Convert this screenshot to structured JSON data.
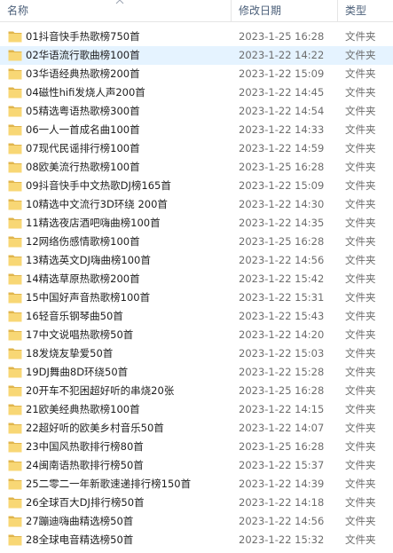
{
  "columns": {
    "name": "名称",
    "date": "修改日期",
    "type": "类型"
  },
  "icons": {
    "folder": "folder-icon",
    "sort": "sort-up-icon"
  },
  "colors": {
    "selected_row": "#e5f3ff",
    "folder": "#f8d775",
    "folder_dark": "#e0b54c"
  },
  "selected_index": 1,
  "rows": [
    {
      "name": "01抖音快手热歌榜750首",
      "date": "2023-1-25 16:28",
      "type": "文件夹"
    },
    {
      "name": "02华语流行歌曲榜100首",
      "date": "2023-1-22 14:22",
      "type": "文件夹"
    },
    {
      "name": "03华语经典热歌榜200首",
      "date": "2023-1-22 15:09",
      "type": "文件夹"
    },
    {
      "name": "04磁性hifi发烧人声200首",
      "date": "2023-1-22 14:45",
      "type": "文件夹"
    },
    {
      "name": "05精选粤语热歌榜300首",
      "date": "2023-1-22 14:54",
      "type": "文件夹"
    },
    {
      "name": "06一人一首成名曲100首",
      "date": "2023-1-22 14:33",
      "type": "文件夹"
    },
    {
      "name": "07现代民谣排行榜100首",
      "date": "2023-1-22 14:59",
      "type": "文件夹"
    },
    {
      "name": "08欧美流行热歌榜100首",
      "date": "2023-1-25 16:28",
      "type": "文件夹"
    },
    {
      "name": "09抖音快手中文热歌DJ榜165首",
      "date": "2023-1-22 15:09",
      "type": "文件夹"
    },
    {
      "name": "10精选中文流行3D环绕 200首",
      "date": "2023-1-22 14:30",
      "type": "文件夹"
    },
    {
      "name": "11精选夜店酒吧嗨曲榜100首",
      "date": "2023-1-22 14:35",
      "type": "文件夹"
    },
    {
      "name": "12网络伤感情歌榜100首",
      "date": "2023-1-25 16:28",
      "type": "文件夹"
    },
    {
      "name": "13精选英文DJ嗨曲榜100首",
      "date": "2023-1-22 14:56",
      "type": "文件夹"
    },
    {
      "name": "14精选草原热歌榜200首",
      "date": "2023-1-22 15:42",
      "type": "文件夹"
    },
    {
      "name": "15中国好声音热歌榜100首",
      "date": "2023-1-22 15:31",
      "type": "文件夹"
    },
    {
      "name": "16轻音乐钢琴曲50首",
      "date": "2023-1-22 15:43",
      "type": "文件夹"
    },
    {
      "name": "17中文说唱热歌榜50首",
      "date": "2023-1-22 14:20",
      "type": "文件夹"
    },
    {
      "name": "18发烧友挚爱50首",
      "date": "2023-1-22 15:03",
      "type": "文件夹"
    },
    {
      "name": "19DJ舞曲8D环绕50首",
      "date": "2023-1-22 15:28",
      "type": "文件夹"
    },
    {
      "name": "20开车不犯困超好听的串烧20张",
      "date": "2023-1-25 16:28",
      "type": "文件夹"
    },
    {
      "name": "21欧美经典热歌榜100首",
      "date": "2023-1-22 14:15",
      "type": "文件夹"
    },
    {
      "name": "22超好听的欧美乡村音乐50首",
      "date": "2023-1-22 14:07",
      "type": "文件夹"
    },
    {
      "name": "23中国风热歌排行榜80首",
      "date": "2023-1-25 16:28",
      "type": "文件夹"
    },
    {
      "name": "24闽南语热歌排行榜50首",
      "date": "2023-1-22 15:37",
      "type": "文件夹"
    },
    {
      "name": "25二零二一年新歌速递排行榜150首",
      "date": "2023-1-22 14:39",
      "type": "文件夹"
    },
    {
      "name": "26全球百大DJ排行榜50首",
      "date": "2023-1-22 14:18",
      "type": "文件夹"
    },
    {
      "name": "27蹦迪嗨曲精选榜50首",
      "date": "2023-1-22 14:56",
      "type": "文件夹"
    },
    {
      "name": "28全球电音精选榜50首",
      "date": "2023-1-22 15:32",
      "type": "文件夹"
    }
  ]
}
